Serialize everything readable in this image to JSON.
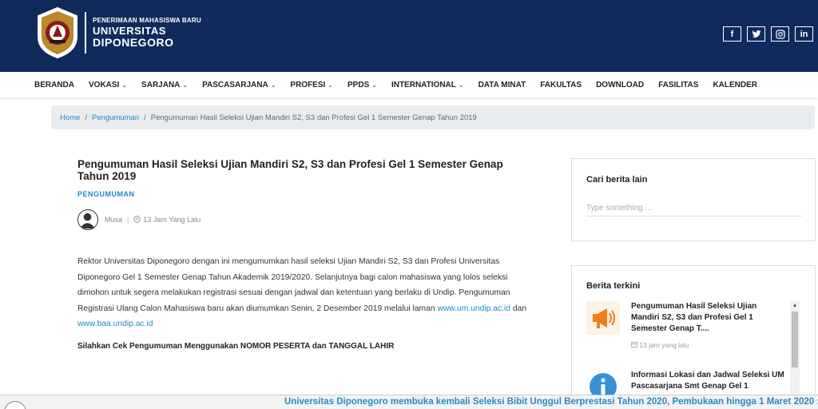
{
  "header": {
    "logo_line1": "PENERIMAAN MAHASISWA BARU",
    "logo_line2": "UNIVERSITAS",
    "logo_line3": "DIPONEGORO",
    "social": [
      "f",
      "t",
      "ig",
      "in"
    ]
  },
  "nav": {
    "items": [
      {
        "label": "BERANDA",
        "dropdown": false
      },
      {
        "label": "VOKASI",
        "dropdown": true
      },
      {
        "label": "SARJANA",
        "dropdown": true
      },
      {
        "label": "PASCASARJANA",
        "dropdown": true
      },
      {
        "label": "PROFESI",
        "dropdown": true
      },
      {
        "label": "PPDS",
        "dropdown": true
      },
      {
        "label": "INTERNATIONAL",
        "dropdown": true
      },
      {
        "label": "DATA MINAT",
        "dropdown": false
      },
      {
        "label": "FAKULTAS",
        "dropdown": false
      },
      {
        "label": "DOWNLOAD",
        "dropdown": false
      },
      {
        "label": "FASILITAS",
        "dropdown": false
      },
      {
        "label": "KALENDER",
        "dropdown": false
      }
    ]
  },
  "breadcrumb": {
    "home": "Home",
    "section": "Pengumuman",
    "current": "Pengumuman Hasil Seleksi Ujian Mandiri S2, S3 dan Profesi Gel 1 Semester Genap Tahun 2019"
  },
  "article": {
    "title": "Pengumuman Hasil Seleksi Ujian Mandiri S2, S3 dan Profesi Gel 1 Semester Genap Tahun 2019",
    "category": "PENGUMUMAN",
    "author": "Musa",
    "time": "13 Jam Yang Lalu",
    "body_part1": "Rektor Universitas Diponegoro dengan ini mengumumkan hasil seleksi Ujian Mandiri S2, S3 dan Profesi Universitas Diponegoro Gel 1 Semester Genap Tahun Akademik 2019/2020. Selanjutnya bagi calon mahasiswa yang lolos seleksi dimohon untuk segera melakukan registrasi sesuai dengan jadwal dan ketentuan yang berlaku di Undip.  Pengumuman Registrasi Ulang Calon Mahasiswa baru akan diumumkan Senin, 2 Desember 2019 melalui laman ",
    "link1": "www.um.undip.ac.id",
    "body_and": " dan ",
    "link2": "www.baa.undip.ac.id",
    "cek": "Silahkan Cek Pengumuman Menggunakan NOMOR PESERTA dan TANGGAL LAHIR"
  },
  "sidebar": {
    "search_title": "Cari berita lain",
    "search_placeholder": "Type something....",
    "recent_title": "Berita terkini",
    "recent_items": [
      {
        "title": "Pengumuman Hasil Seleksi Ujian Mandiri S2, S3 dan Profesi Gel 1 Semester Genap T....",
        "time": "13 jam yang lalu",
        "icon": "megaphone-icon"
      },
      {
        "title": "Informasi Lokasi dan Jadwal Seleksi UM Pascasarjana Smt Genap Gel 1",
        "time": "",
        "icon": "info-icon"
      }
    ]
  },
  "ticker": {
    "text": "Universitas Diponegoro membuka kembali Seleksi Bibit Unggul Berprestasi Tahun 2020, Pembukaan hingga 1 Maret 2020 :"
  },
  "colors": {
    "header_bg": "#102a5c",
    "link": "#1e88c7",
    "ticker_text": "#2b88c8"
  }
}
